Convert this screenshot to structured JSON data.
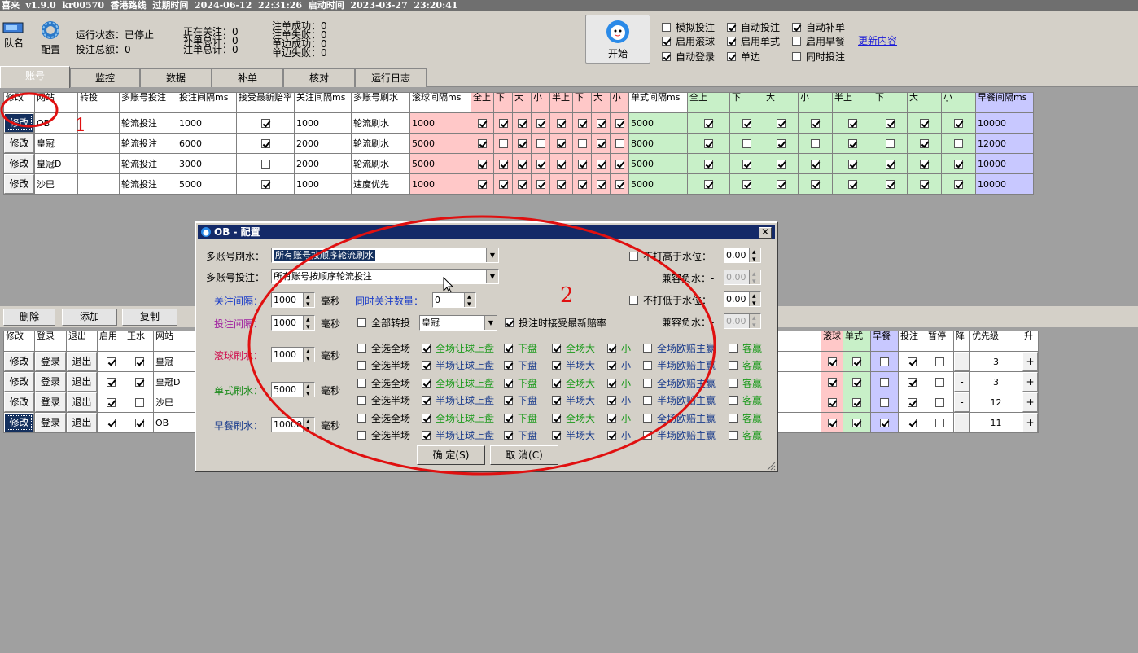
{
  "window": {
    "title": "喜来  v1.9.0  kr00570  香港路线  过期时间  2024-06-12  22:31:26  启动时间  2023-03-27  23:20:41"
  },
  "toolbar": {
    "team_label": "队名",
    "config_label": "配置",
    "run_status": "运行状态：已停止",
    "bet_total": "投注总额：0",
    "watching": "正在关注：0",
    "supplement_total": "补单总计：0",
    "bet_count": "注单总计：0",
    "order_success": "注单成功：0",
    "order_fail": "注单失败：0",
    "single_success": "单边成功：0",
    "single_fail": "单边失败：0",
    "start_label": "开始",
    "options": [
      {
        "label": "模拟投注",
        "checked": false
      },
      {
        "label": "自动投注",
        "checked": true
      },
      {
        "label": "自动补单",
        "checked": true
      },
      {
        "label": "启用滚球",
        "checked": true
      },
      {
        "label": "启用单式",
        "checked": true
      },
      {
        "label": "启用早餐",
        "checked": false
      },
      {
        "label": "自动登录",
        "checked": true
      },
      {
        "label": "单边",
        "checked": true
      },
      {
        "label": "同时投注",
        "checked": false
      }
    ],
    "update_link": "更新内容"
  },
  "tabs": [
    "账号",
    "监控",
    "数据",
    "补单",
    "核对",
    "运行日志"
  ],
  "top_table": {
    "headers": [
      "修改",
      "网站",
      "转投",
      "多账号投注",
      "投注间隔ms",
      "接受最新赔率",
      "关注间隔ms",
      "多账号刷水",
      "滚球间隔ms",
      "全上",
      "下",
      "大",
      "小",
      "半上",
      "下",
      "大",
      "小",
      "单式间隔ms",
      "全上",
      "下",
      "大",
      "小",
      "半上",
      "下",
      "大",
      "小",
      "早餐间隔ms"
    ],
    "rows": [
      {
        "edit": "修改",
        "site": "OB",
        "transfer": "",
        "multi_bet": "轮流投注",
        "bet_interval": "1000",
        "accept": true,
        "watch_interval": "1000",
        "multi_refresh": "轮流刷水",
        "roll_interval": "1000",
        "roll_checks": [
          true,
          true,
          true,
          true,
          true,
          true,
          true,
          true
        ],
        "single_interval": "5000",
        "single_checks": [
          true,
          true,
          true,
          true,
          true,
          true,
          true,
          true
        ],
        "early_interval": "10000"
      },
      {
        "edit": "修改",
        "site": "皇冠",
        "transfer": "",
        "multi_bet": "轮流投注",
        "bet_interval": "6000",
        "accept": true,
        "watch_interval": "2000",
        "multi_refresh": "轮流刷水",
        "roll_interval": "5000",
        "roll_checks": [
          true,
          false,
          true,
          false,
          true,
          false,
          true,
          false
        ],
        "single_interval": "8000",
        "single_checks": [
          true,
          false,
          true,
          false,
          true,
          false,
          true,
          false
        ],
        "early_interval": "12000"
      },
      {
        "edit": "修改",
        "site": "皇冠D",
        "transfer": "",
        "multi_bet": "轮流投注",
        "bet_interval": "3000",
        "accept": false,
        "watch_interval": "2000",
        "multi_refresh": "轮流刷水",
        "roll_interval": "5000",
        "roll_checks": [
          true,
          true,
          true,
          true,
          true,
          true,
          true,
          true
        ],
        "single_interval": "5000",
        "single_checks": [
          true,
          true,
          true,
          true,
          true,
          true,
          true,
          true
        ],
        "early_interval": "10000"
      },
      {
        "edit": "修改",
        "site": "沙巴",
        "transfer": "",
        "multi_bet": "轮流投注",
        "bet_interval": "5000",
        "accept": true,
        "watch_interval": "1000",
        "multi_refresh": "速度优先",
        "roll_interval": "1000",
        "roll_checks": [
          true,
          true,
          true,
          true,
          true,
          true,
          true,
          true
        ],
        "single_interval": "5000",
        "single_checks": [
          true,
          true,
          true,
          true,
          true,
          true,
          true,
          true
        ],
        "early_interval": "10000"
      }
    ]
  },
  "annotations": {
    "one": "1",
    "two": "2"
  },
  "mid_buttons": [
    "删除",
    "添加",
    "复制"
  ],
  "bottom_table": {
    "headers_left": [
      "修改",
      "登录",
      "退出",
      "启用",
      "正水",
      "网站"
    ],
    "headers_right": [
      "滚球",
      "单式",
      "早餐",
      "投注",
      "暂停",
      "降",
      "优先级",
      "升"
    ],
    "rows": [
      {
        "edit": "修改",
        "login": "登录",
        "logout": "退出",
        "enabled": true,
        "positive": true,
        "site": "皇冠",
        "roll": true,
        "single": true,
        "early": false,
        "bet": true,
        "pause": false,
        "down": "-",
        "priority": "3",
        "up": "+"
      },
      {
        "edit": "修改",
        "login": "登录",
        "logout": "退出",
        "enabled": true,
        "positive": true,
        "site": "皇冠D",
        "roll": true,
        "single": true,
        "early": false,
        "bet": true,
        "pause": false,
        "down": "-",
        "priority": "3",
        "up": "+"
      },
      {
        "edit": "修改",
        "login": "登录",
        "logout": "退出",
        "enabled": true,
        "positive": false,
        "site": "沙巴",
        "roll": true,
        "single": true,
        "early": false,
        "bet": true,
        "pause": false,
        "down": "-",
        "priority": "12",
        "up": "+"
      },
      {
        "edit": "修改",
        "login": "登录",
        "logout": "退出",
        "enabled": true,
        "positive": true,
        "site": "OB",
        "roll": true,
        "single": true,
        "early": true,
        "bet": true,
        "pause": false,
        "down": "-",
        "priority": "11",
        "up": "+"
      }
    ]
  },
  "dialog": {
    "title": "OB - 配置",
    "multi_refresh_label": "多账号刷水：",
    "multi_refresh_value": "所有账号按顺序轮流刷水",
    "multi_bet_label": "多账号投注：",
    "multi_bet_value": "所有账号按顺序轮流投注",
    "watch_interval_label": "关注间隔：",
    "watch_interval_value": "1000",
    "bet_interval_label": "投注间隔：",
    "bet_interval_value": "1000",
    "ms": "毫秒",
    "concurrent_label": "同时关注数量：",
    "concurrent_value": "0",
    "transfer_all_label": "全部转投",
    "transfer_site": "皇冠",
    "accept_latest_label": "投注时接受最新赔率",
    "no_higher_label": "不打高于水位：",
    "no_higher_value": "0.00",
    "compat_neg1_label": "兼容负水：-",
    "compat_neg1_value": "0.00",
    "no_lower_label": "不打低于水位：",
    "no_lower_value": "0.00",
    "compat_neg2_label": "兼容负水：-",
    "compat_neg2_value": "0.00",
    "roll_refresh_label": "滚球刷水：",
    "roll_refresh_value": "1000",
    "single_refresh_label": "单式刷水：",
    "single_refresh_value": "5000",
    "early_refresh_label": "早餐刷水：",
    "early_refresh_value": "10000",
    "option_rows": [
      [
        {
          "l": "全选全场",
          "c": false
        },
        {
          "l": "全场让球上盘",
          "c": true
        },
        {
          "l": "下盘",
          "c": true
        },
        {
          "l": "全场大",
          "c": true
        },
        {
          "l": "小",
          "c": true
        },
        {
          "l": "全场欧赔主赢",
          "c": false
        },
        {
          "l": "客赢",
          "c": false
        }
      ],
      [
        {
          "l": "全选半场",
          "c": false
        },
        {
          "l": "半场让球上盘",
          "c": true
        },
        {
          "l": "下盘",
          "c": true
        },
        {
          "l": "半场大",
          "c": true
        },
        {
          "l": "小",
          "c": true
        },
        {
          "l": "半场欧赔主赢",
          "c": false
        },
        {
          "l": "客赢",
          "c": false
        }
      ],
      [
        {
          "l": "全选全场",
          "c": false
        },
        {
          "l": "全场让球上盘",
          "c": true
        },
        {
          "l": "下盘",
          "c": true
        },
        {
          "l": "全场大",
          "c": true
        },
        {
          "l": "小",
          "c": true
        },
        {
          "l": "全场欧赔主赢",
          "c": false
        },
        {
          "l": "客赢",
          "c": false
        }
      ],
      [
        {
          "l": "全选半场",
          "c": false
        },
        {
          "l": "半场让球上盘",
          "c": true
        },
        {
          "l": "下盘",
          "c": true
        },
        {
          "l": "半场大",
          "c": true
        },
        {
          "l": "小",
          "c": true
        },
        {
          "l": "半场欧赔主赢",
          "c": false
        },
        {
          "l": "客赢",
          "c": false
        }
      ],
      [
        {
          "l": "全选全场",
          "c": false
        },
        {
          "l": "全场让球上盘",
          "c": true
        },
        {
          "l": "下盘",
          "c": true
        },
        {
          "l": "全场大",
          "c": true
        },
        {
          "l": "小",
          "c": true
        },
        {
          "l": "全场欧赔主赢",
          "c": false
        },
        {
          "l": "客赢",
          "c": false
        }
      ],
      [
        {
          "l": "全选半场",
          "c": false
        },
        {
          "l": "半场让球上盘",
          "c": true
        },
        {
          "l": "下盘",
          "c": true
        },
        {
          "l": "半场大",
          "c": true
        },
        {
          "l": "小",
          "c": true
        },
        {
          "l": "半场欧赔主赢",
          "c": false
        },
        {
          "l": "客赢",
          "c": false
        }
      ]
    ],
    "ok_label": "确 定(S)",
    "cancel_label": "取 消(C)"
  }
}
